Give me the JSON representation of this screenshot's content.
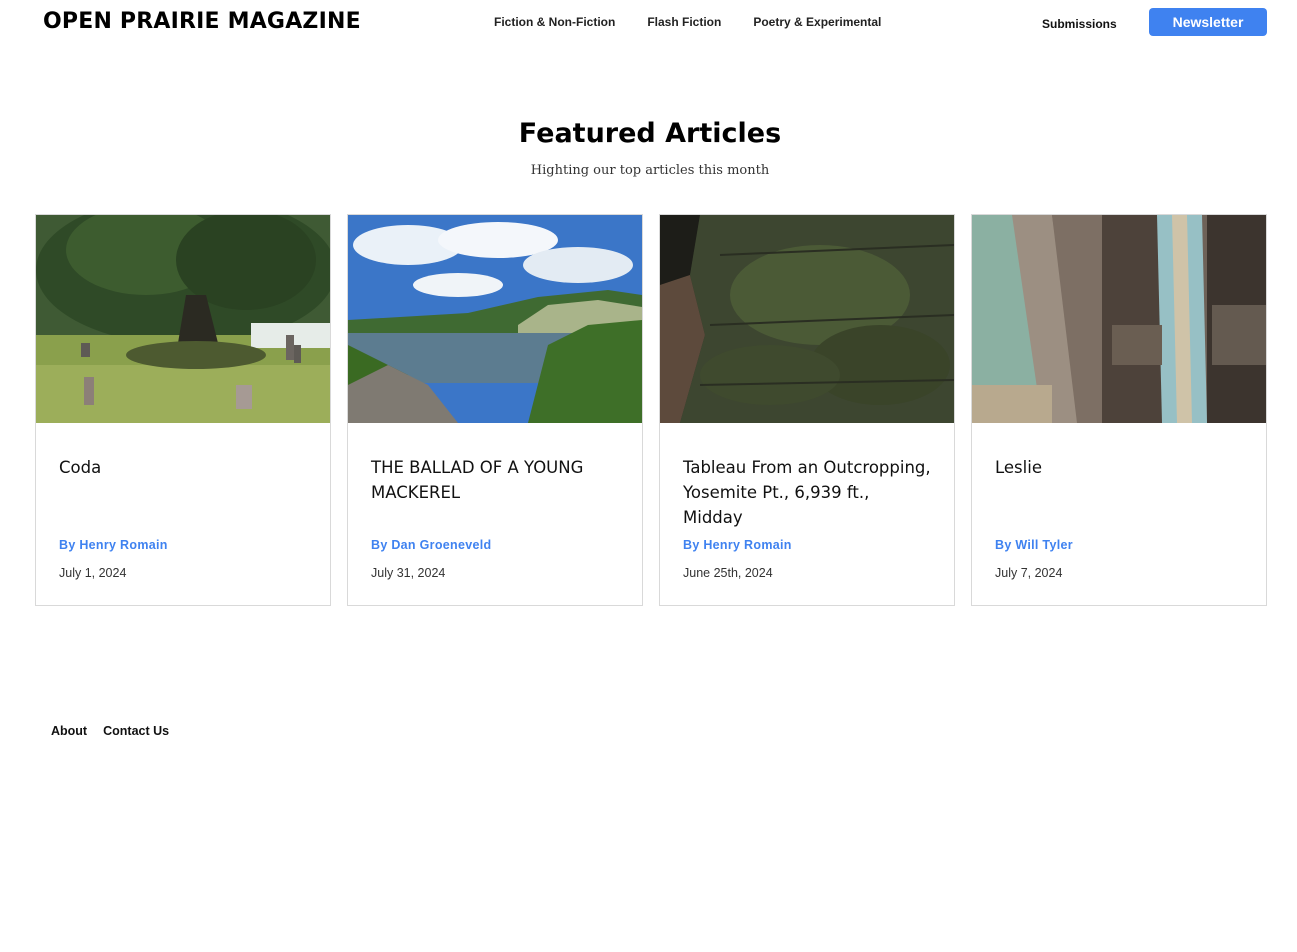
{
  "header": {
    "brand": "OPEN PRAIRIE MAGAZINE",
    "nav": [
      {
        "label": "Fiction & Non-Fiction"
      },
      {
        "label": "Flash Fiction"
      },
      {
        "label": "Poetry & Experimental"
      }
    ],
    "submissions_label": "Submissions",
    "newsletter_label": "Newsletter"
  },
  "main": {
    "title": "Featured Articles",
    "subtitle": "Highting our top articles this month",
    "cards": [
      {
        "title": "Coda",
        "author": "By Henry Romain",
        "date": "July 1, 2024",
        "image": "cemetery-tree-photo"
      },
      {
        "title": "THE BALLAD OF A YOUNG MACKEREL",
        "author": "By Dan Groeneveld",
        "date": "July 31, 2024",
        "image": "lake-bluff-photo"
      },
      {
        "title": "Tableau From an Outcropping, Yosemite Pt., 6,939 ft., Midday",
        "author": "By Henry Romain",
        "date": "June 25th, 2024",
        "image": "mossy-rock-face-photo"
      },
      {
        "title": "Leslie",
        "author": "By Will Tyler",
        "date": "July 7, 2024",
        "image": "peeling-paint-wood-photo"
      }
    ]
  },
  "footer": {
    "links": [
      {
        "label": "About"
      },
      {
        "label": "Contact Us"
      }
    ]
  },
  "colors": {
    "accent": "#3f82f0",
    "text": "#111111",
    "border": "#d9d9d9"
  }
}
